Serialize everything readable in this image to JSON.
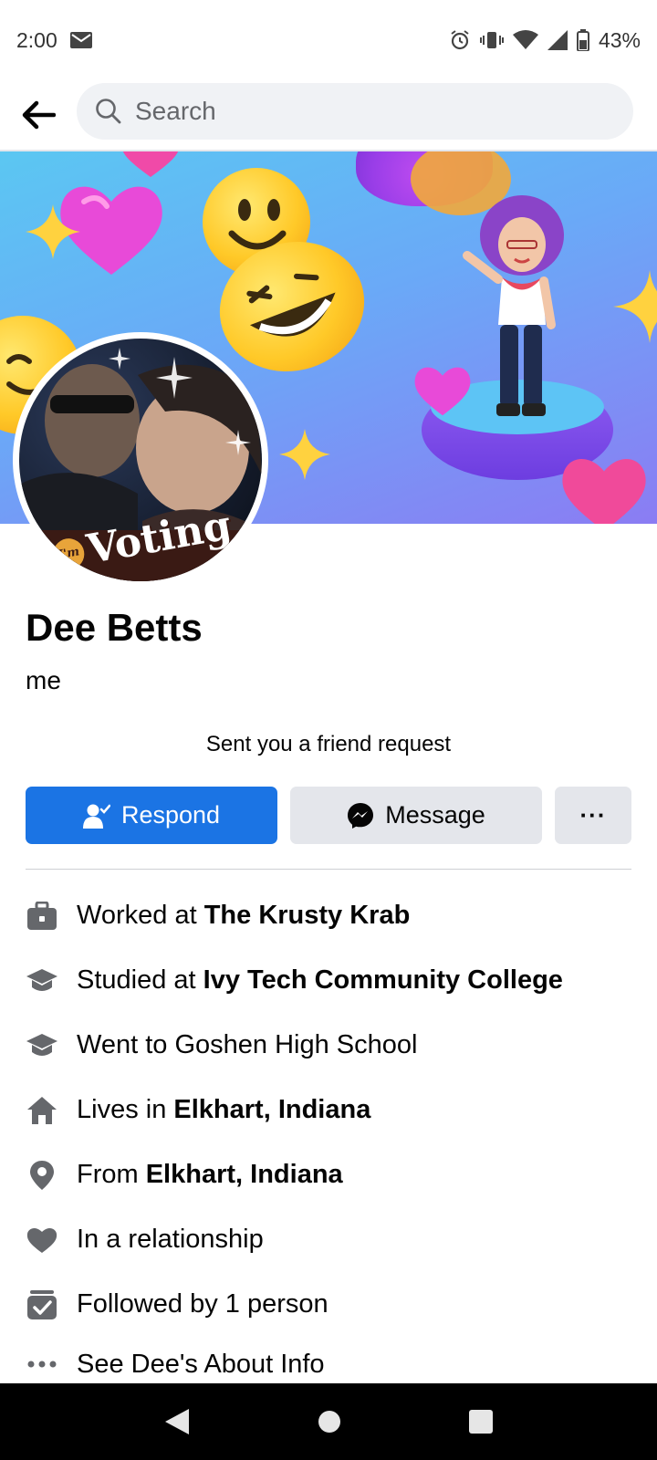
{
  "status_bar": {
    "time": "2:00",
    "battery": "43%",
    "icons": [
      "mail-icon",
      "alarm-icon",
      "vibrate-icon",
      "wifi-icon",
      "signal-icon",
      "battery-icon"
    ]
  },
  "search": {
    "placeholder": "Search"
  },
  "profile": {
    "name": "Dee Betts",
    "subtitle": "me",
    "friend_request_text": "Sent you a friend request",
    "avatar_badge_small": "I'm",
    "avatar_badge_large": "Voting"
  },
  "actions": {
    "respond_label": "Respond",
    "message_label": "Message",
    "more_label": "···"
  },
  "info": [
    {
      "icon": "briefcase-icon",
      "prefix": "Worked at ",
      "bold": "The Krusty Krab"
    },
    {
      "icon": "graduation-cap-icon",
      "prefix": "Studied at ",
      "bold": "Ivy Tech Community College"
    },
    {
      "icon": "graduation-cap-icon",
      "prefix": "Went to Goshen High School",
      "bold": ""
    },
    {
      "icon": "home-icon",
      "prefix": "Lives in ",
      "bold": "Elkhart, Indiana"
    },
    {
      "icon": "location-pin-icon",
      "prefix": "From ",
      "bold": "Elkhart, Indiana"
    },
    {
      "icon": "heart-icon",
      "prefix": "In a relationship",
      "bold": ""
    },
    {
      "icon": "followers-icon",
      "prefix": "Followed by 1 person",
      "bold": ""
    }
  ],
  "see_about": "See Dee's About Info",
  "colors": {
    "primary": "#1b74e4",
    "secondary_button": "#e4e6eb",
    "icon_gray": "#65676b"
  }
}
